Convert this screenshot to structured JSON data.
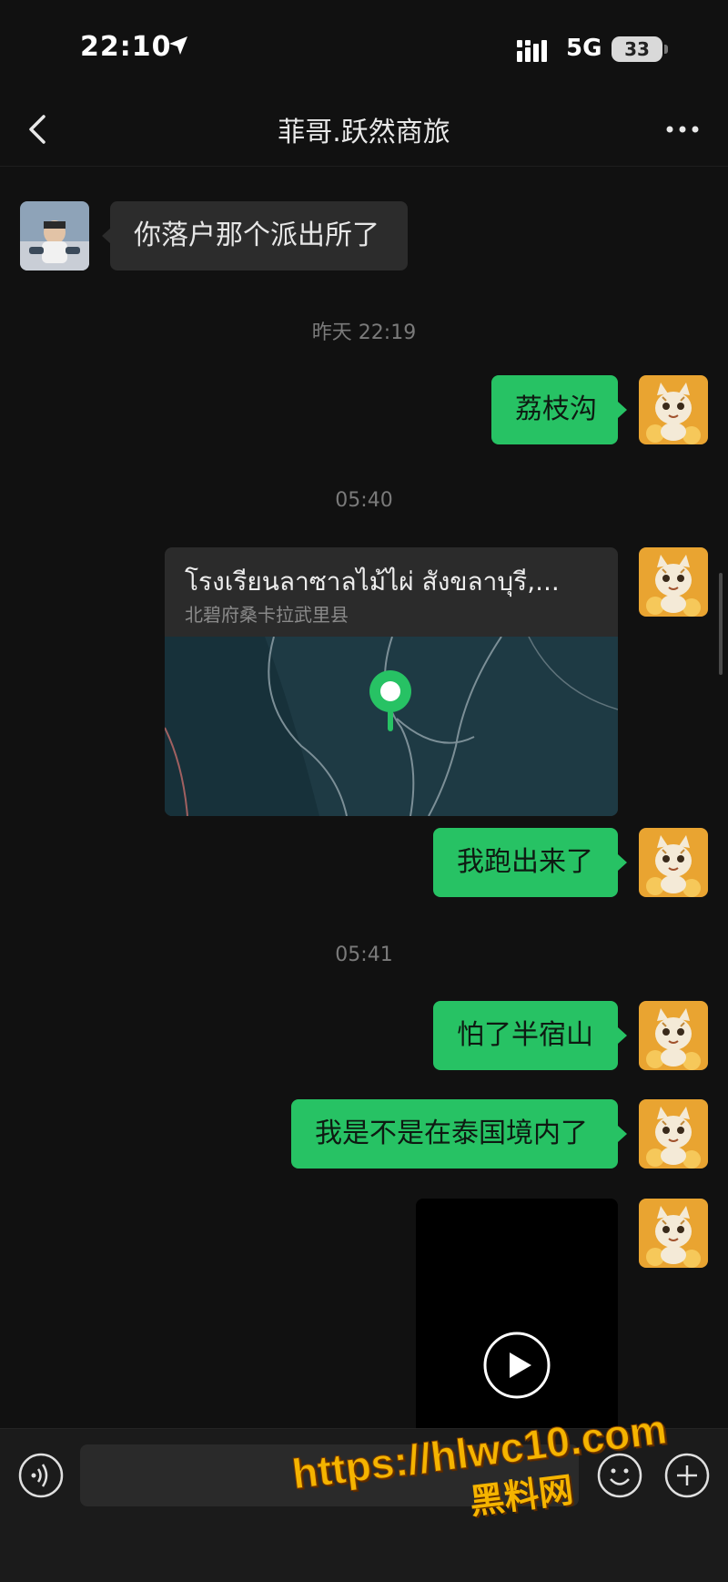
{
  "status_bar": {
    "time": "22:10",
    "network": "5G",
    "battery": "33"
  },
  "header": {
    "title": "菲哥.跃然商旅"
  },
  "messages": [
    {
      "type": "text",
      "side": "in",
      "text": "你落户那个派出所了"
    },
    {
      "type": "timestamp",
      "text": "昨天 22:19"
    },
    {
      "type": "text",
      "side": "out",
      "text": "荔枝沟"
    },
    {
      "type": "timestamp",
      "text": "05:40"
    },
    {
      "type": "location",
      "side": "out",
      "title": "โรงเรียนลาซาลไม้ไผ่ สังขลาบุรี,...",
      "subtitle": "北碧府桑卡拉武里县"
    },
    {
      "type": "text",
      "side": "out",
      "text": "我跑出来了"
    },
    {
      "type": "timestamp",
      "text": "05:41"
    },
    {
      "type": "text",
      "side": "out",
      "text": "怕了半宿山"
    },
    {
      "type": "text",
      "side": "out",
      "text": "我是不是在泰国境内了"
    },
    {
      "type": "video",
      "side": "out"
    }
  ],
  "input_bar": {
    "placeholder": ""
  },
  "watermark": {
    "url": "https://hlwc10.com",
    "name": "黑料网"
  },
  "colors": {
    "background": "#111111",
    "outgoing_bubble": "#27c264",
    "incoming_bubble": "#2c2c2c",
    "watermark": "#f5b400"
  },
  "icons": [
    "location-arrow-icon",
    "signal-icon",
    "back-icon",
    "more-icon",
    "map-pin-icon",
    "play-icon",
    "voice-icon",
    "emoji-icon",
    "plus-icon"
  ]
}
